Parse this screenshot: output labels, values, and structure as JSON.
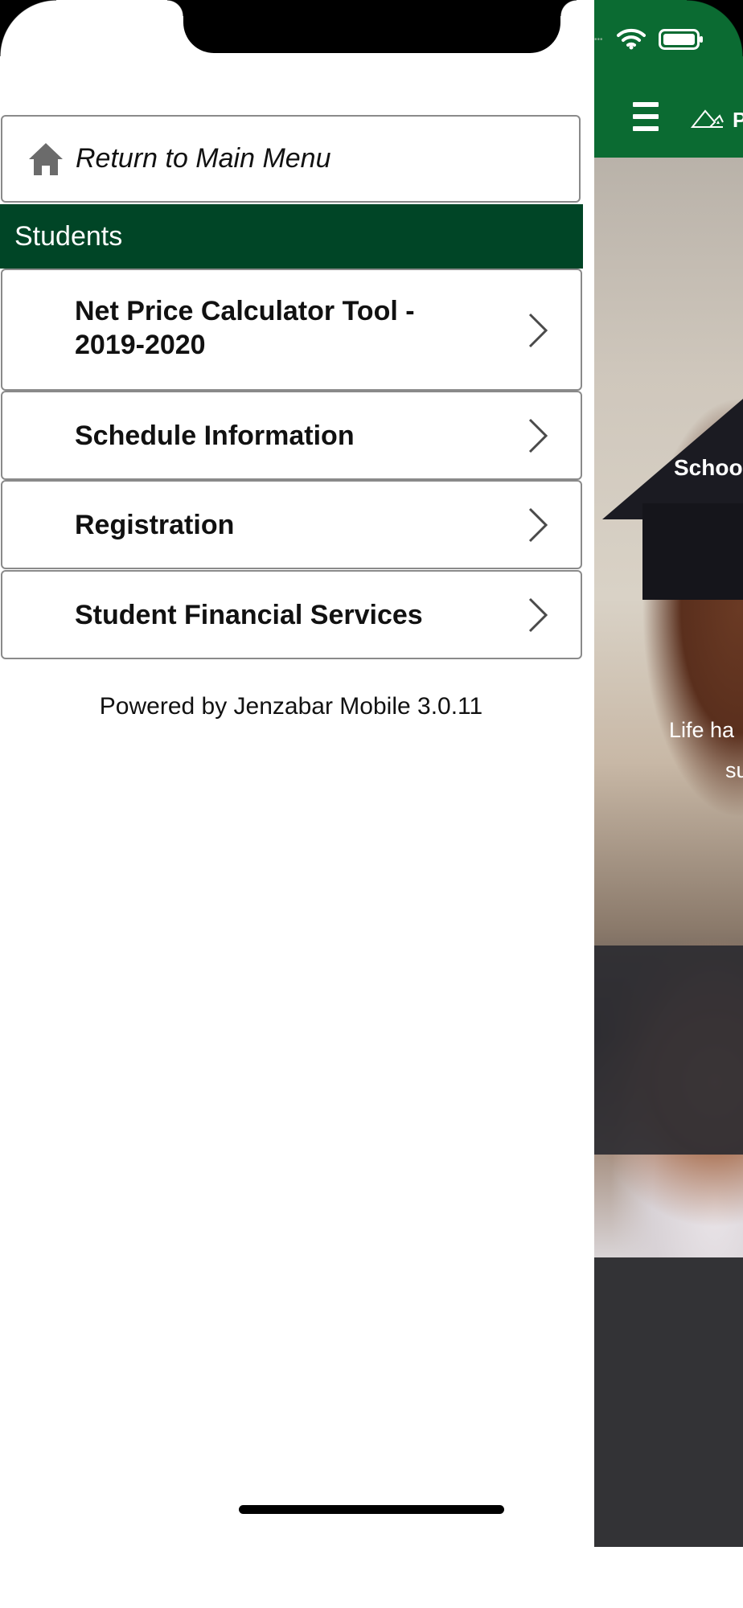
{
  "drawer": {
    "return_label": "Return to Main Menu",
    "section_title": "Students",
    "items": [
      {
        "line1": "Net Price Calculator Tool -",
        "line2": "2019-2020"
      },
      {
        "label": "Schedule Information"
      },
      {
        "label": "Registration"
      },
      {
        "label": "Student Financial Services"
      }
    ],
    "footer": "Powered by Jenzabar Mobile 3.0.11"
  },
  "background_app": {
    "logo_partial_text": "P",
    "hero_text_1": "Schoo",
    "hero_text_2": "Life ha",
    "hero_text_3": "su",
    "colors": {
      "brand_green": "#0b6b32",
      "section_green": "#004526",
      "footer_dark": "#333336"
    }
  },
  "icons": [
    "home-icon",
    "chevron-right-icon",
    "hamburger-menu-icon",
    "wifi-icon",
    "battery-icon"
  ]
}
